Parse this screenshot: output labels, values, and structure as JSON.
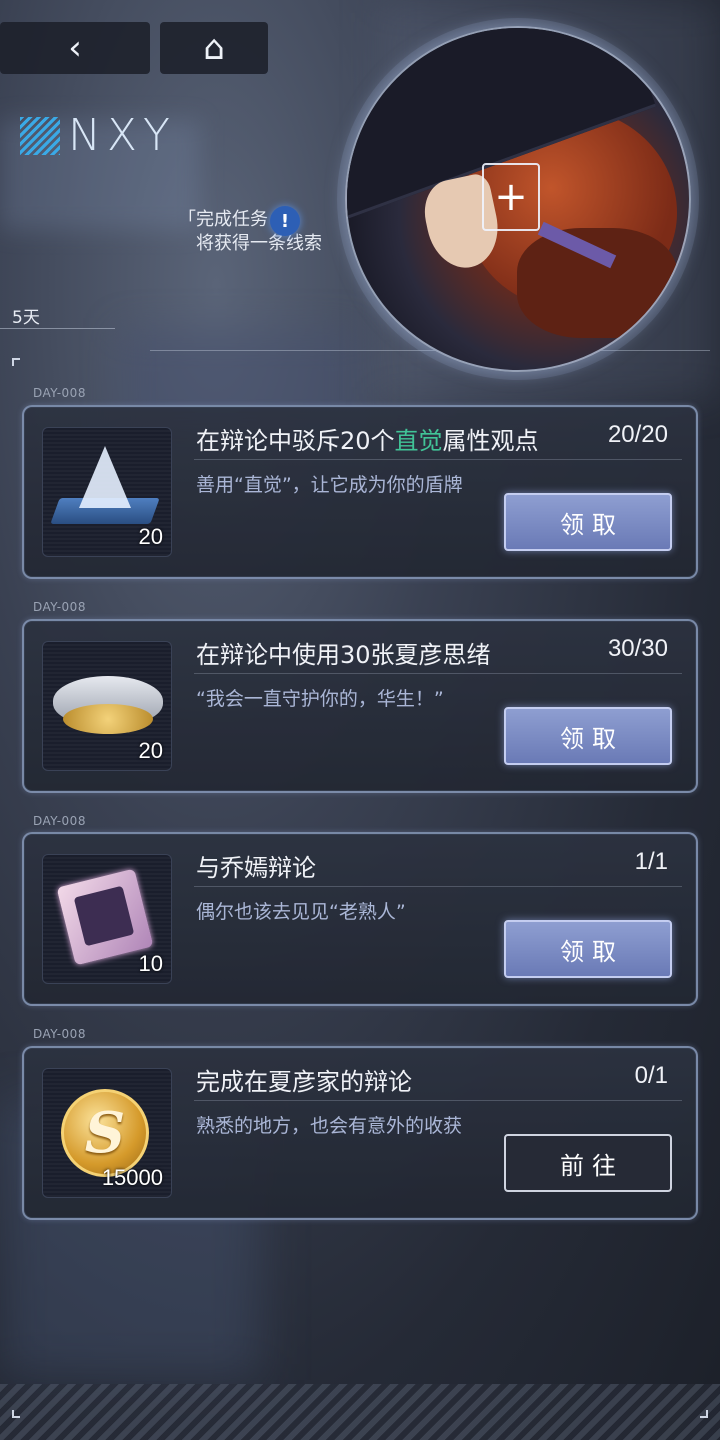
{
  "nav": {
    "back_icon": "chevron-left-icon",
    "home_icon": "home-icon",
    "back_glyph": "‹",
    "home_glyph": "⌂"
  },
  "logo": {
    "text": "NXY"
  },
  "hint": {
    "line1": "「完成任务",
    "line2": "将获得一条线索",
    "bubble": "!"
  },
  "days_left": "5天",
  "tasks": [
    {
      "day": "DAY-008",
      "title_pre": "在辩论中驳斥20个",
      "title_hl": "直觉",
      "title_post": "属性观点",
      "progress": "20/20",
      "desc": "善用“直觉”，让它成为你的盾牌",
      "item_icon": "crystal-pyramid-icon",
      "qty": "20",
      "action": "领取",
      "action_state": "claim"
    },
    {
      "day": "DAY-008",
      "title_pre": "在辩论中使用30张夏彦思绪",
      "title_hl": "",
      "title_post": "",
      "progress": "30/30",
      "desc": "“我会一直守护你的，华生！”",
      "item_icon": "gold-bowl-icon",
      "qty": "20",
      "action": "领取",
      "action_state": "claim"
    },
    {
      "day": "DAY-008",
      "title_pre": "与乔嫣辩论",
      "title_hl": "",
      "title_post": "",
      "progress": "1/1",
      "desc": "偶尔也该去见见“老熟人”",
      "item_icon": "memory-chip-icon",
      "qty": "10",
      "action": "领取",
      "action_state": "claim"
    },
    {
      "day": "DAY-008",
      "title_pre": "完成在夏彦家的辩论",
      "title_hl": "",
      "title_post": "",
      "progress": "0/1",
      "desc": "熟悉的地方，也会有意外的收获",
      "item_icon": "gold-coin-icon",
      "qty": "15000",
      "action": "前往",
      "action_state": "goto"
    }
  ],
  "colors": {
    "highlight": "#41c497",
    "claim_button": "#7f8fc8",
    "card_border": "#96aacd"
  }
}
